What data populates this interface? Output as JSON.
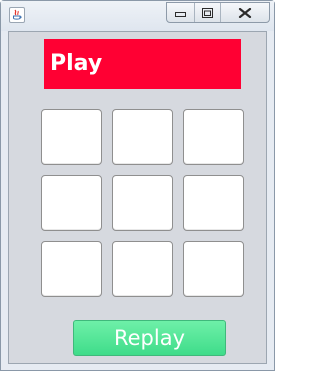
{
  "window": {
    "app_icon": "java-cup-icon",
    "controls": [
      "minimize-icon",
      "maximize-icon",
      "close-icon"
    ]
  },
  "status": {
    "label": "Play",
    "color": "#ff0033"
  },
  "board": {
    "cells": [
      "",
      "",
      "",
      "",
      "",
      "",
      "",
      "",
      ""
    ]
  },
  "replay": {
    "label": "Replay",
    "color": "#4ce896"
  }
}
